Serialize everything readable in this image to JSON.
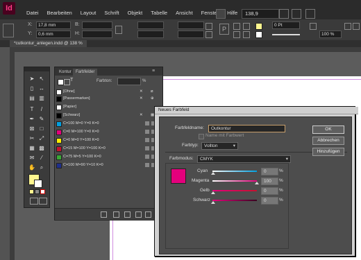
{
  "app": {
    "logo": "Id",
    "zoom": "138,9"
  },
  "menu": [
    "Datei",
    "Bearbeiten",
    "Layout",
    "Schrift",
    "Objekt",
    "Tabelle",
    "Ansicht",
    "Fenster",
    "Hilfe"
  ],
  "control": {
    "x_label": "X:",
    "x_value": "17,8 mm",
    "y_label": "Y:",
    "y_value": "0,6 mm",
    "w_label": "B:",
    "h_label": "H:",
    "pt_value": "0 Pt",
    "pct_value": "100 %"
  },
  "document": {
    "tab_title": "*cutkontur_anlegen.indd @ 138 %"
  },
  "swatches_panel": {
    "tabs": [
      "Kontur",
      "Farbfelder"
    ],
    "tone_label": "Farbton:",
    "tone_value": "%",
    "items": [
      {
        "name": "[Ohne]",
        "color": "#ffffff"
      },
      {
        "name": "[Passermarken]",
        "color": "#000000"
      },
      {
        "name": "[Papier]",
        "color": "#ffffff"
      },
      {
        "name": "[Schwarz]",
        "color": "#000000"
      },
      {
        "name": "C=100 M=0 Y=0 K=0",
        "color": "#00a0e0"
      },
      {
        "name": "C=0 M=100 Y=0 K=0",
        "color": "#e4007c"
      },
      {
        "name": "C=0 M=0 Y=100 K=0",
        "color": "#fff000"
      },
      {
        "name": "C=15 M=100 Y=100 K=0",
        "color": "#c8102e"
      },
      {
        "name": "C=75 M=5 Y=100 K=0",
        "color": "#3aa935"
      },
      {
        "name": "C=100 M=90 Y=10 K=0",
        "color": "#1f2f8c"
      }
    ]
  },
  "dialog": {
    "title": "Neues Farbfeld",
    "name_label": "Farbfeldname:",
    "name_value": "Outkontur",
    "name_checkbox": "Name mit Farbwert",
    "type_label": "Farbtyp:",
    "type_value": "Vollton",
    "mode_label": "Farbmodus:",
    "mode_value": "CMYK",
    "preview_color": "#e4007c",
    "sliders": [
      {
        "label": "Cyan",
        "value": "0",
        "color": "#00a0e0"
      },
      {
        "label": "Magenta",
        "value": "100",
        "color": "#e4007c"
      },
      {
        "label": "Gelb",
        "value": "0",
        "color": "#fff000"
      },
      {
        "label": "Schwarz",
        "value": "0",
        "color": "#000000"
      }
    ],
    "unit": "%",
    "buttons": {
      "ok": "OK",
      "cancel": "Abbrechen",
      "add": "Hinzufügen"
    }
  }
}
